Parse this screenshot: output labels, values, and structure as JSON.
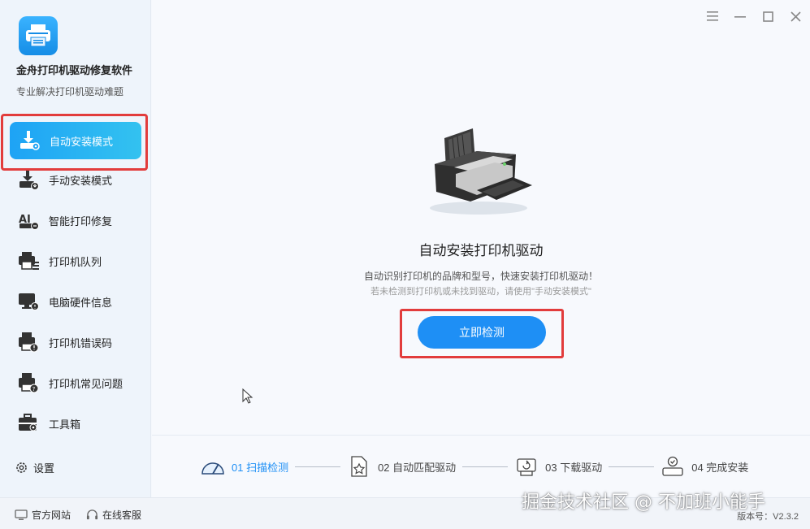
{
  "app": {
    "title": "金舟打印机驱动修复软件",
    "subtitle": "专业解决打印机驱动难题"
  },
  "sidebar": {
    "items": [
      {
        "label": "自动安装模式",
        "icon": "auto-install-icon",
        "active": true
      },
      {
        "label": "手动安装模式",
        "icon": "manual-install-icon"
      },
      {
        "label": "智能打印修复",
        "icon": "ai-repair-icon"
      },
      {
        "label": "打印机队列",
        "icon": "printer-queue-icon"
      },
      {
        "label": "电脑硬件信息",
        "icon": "hardware-info-icon"
      },
      {
        "label": "打印机错误码",
        "icon": "error-code-icon"
      },
      {
        "label": "打印机常见问题",
        "icon": "faq-icon"
      },
      {
        "label": "工具箱",
        "icon": "toolbox-icon"
      }
    ],
    "settings_label": "设置"
  },
  "main": {
    "title": "自动安装打印机驱动",
    "desc1": "自动识别打印机的品牌和型号，快速安装打印机驱动！",
    "desc2": "若未检测到打印机或未找到驱动，请使用\"手动安装模式\"",
    "detect_button": "立即检测"
  },
  "steps": [
    {
      "label": "01 扫描检测",
      "icon": "gauge-icon",
      "active": true
    },
    {
      "label": "02 自动匹配驱动",
      "icon": "document-star-icon"
    },
    {
      "label": "03 下载驱动",
      "icon": "download-icon"
    },
    {
      "label": "04 完成安装",
      "icon": "check-install-icon"
    }
  ],
  "footer": {
    "website": "官方网站",
    "support": "在线客服",
    "version": "版本号：V2.3.2"
  },
  "watermark": "掘金技术社区 @ 不加班小能手",
  "colors": {
    "accent": "#1e8ff5",
    "highlight_box": "#e23c3c"
  }
}
